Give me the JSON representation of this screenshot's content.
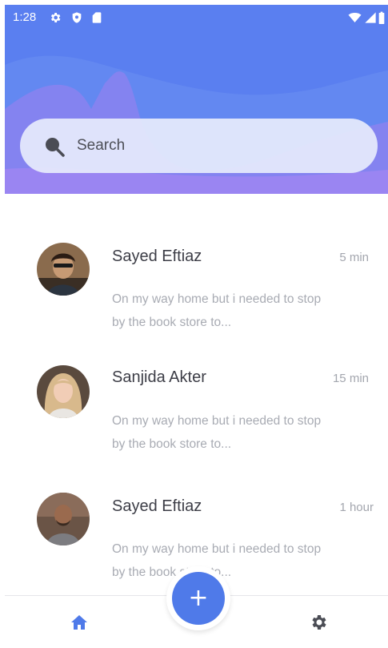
{
  "status_bar": {
    "time": "1:28",
    "icons": [
      "settings-icon",
      "shield-icon",
      "sd-card-icon",
      "wifi-icon",
      "signal-icon",
      "battery-icon"
    ]
  },
  "search": {
    "placeholder": "Search",
    "icon": "search-icon"
  },
  "messages": [
    {
      "name": "Sayed Eftiaz",
      "time": "5 min",
      "preview": "On my way home but i needed to stop by the book store to..."
    },
    {
      "name": "Sanjida Akter",
      "time": "15 min",
      "preview": "On my way home but i needed to stop by the book store to..."
    },
    {
      "name": "Sayed Eftiaz",
      "time": "1 hour",
      "preview": "On my way home but i needed to stop by the book store to..."
    }
  ],
  "bottom_nav": {
    "fab_label": "+",
    "items": [
      "home-icon",
      "settings-icon"
    ]
  },
  "colors": {
    "header_blue": "#5a7ff0",
    "header_purple": "#9a85f2",
    "accent": "#4f7ae9",
    "name_text": "#3c3d46",
    "muted_text": "#a8abb3"
  }
}
